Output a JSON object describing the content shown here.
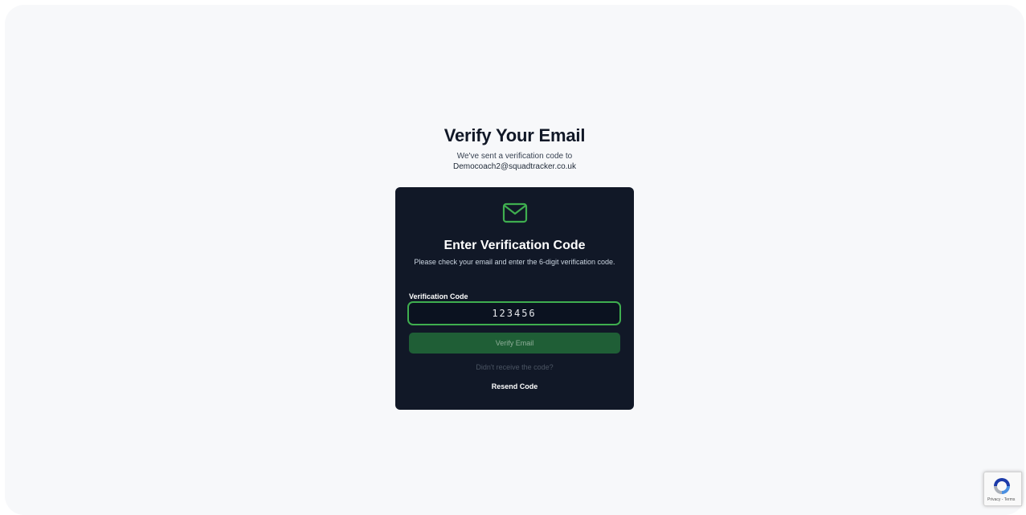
{
  "header": {
    "title": "Verify Your Email",
    "subtitle": "We've sent a verification code to",
    "email": "Democoach2@squadtracker.co.uk"
  },
  "card": {
    "icon": "mail-icon",
    "title": "Enter Verification Code",
    "description": "Please check your email and enter the 6-digit verification code.",
    "field_label": "Verification Code",
    "code_value": "123456",
    "verify_label": "Verify Email",
    "resend_hint": "Didn't receive the code?",
    "resend_label": "Resend Code"
  },
  "recaptcha": {
    "links": "Privacy - Terms"
  },
  "colors": {
    "page_background": "#f7f8fa",
    "card_background": "#111827",
    "accent_green": "#3fae4f",
    "button_green": "#1f5e36"
  }
}
